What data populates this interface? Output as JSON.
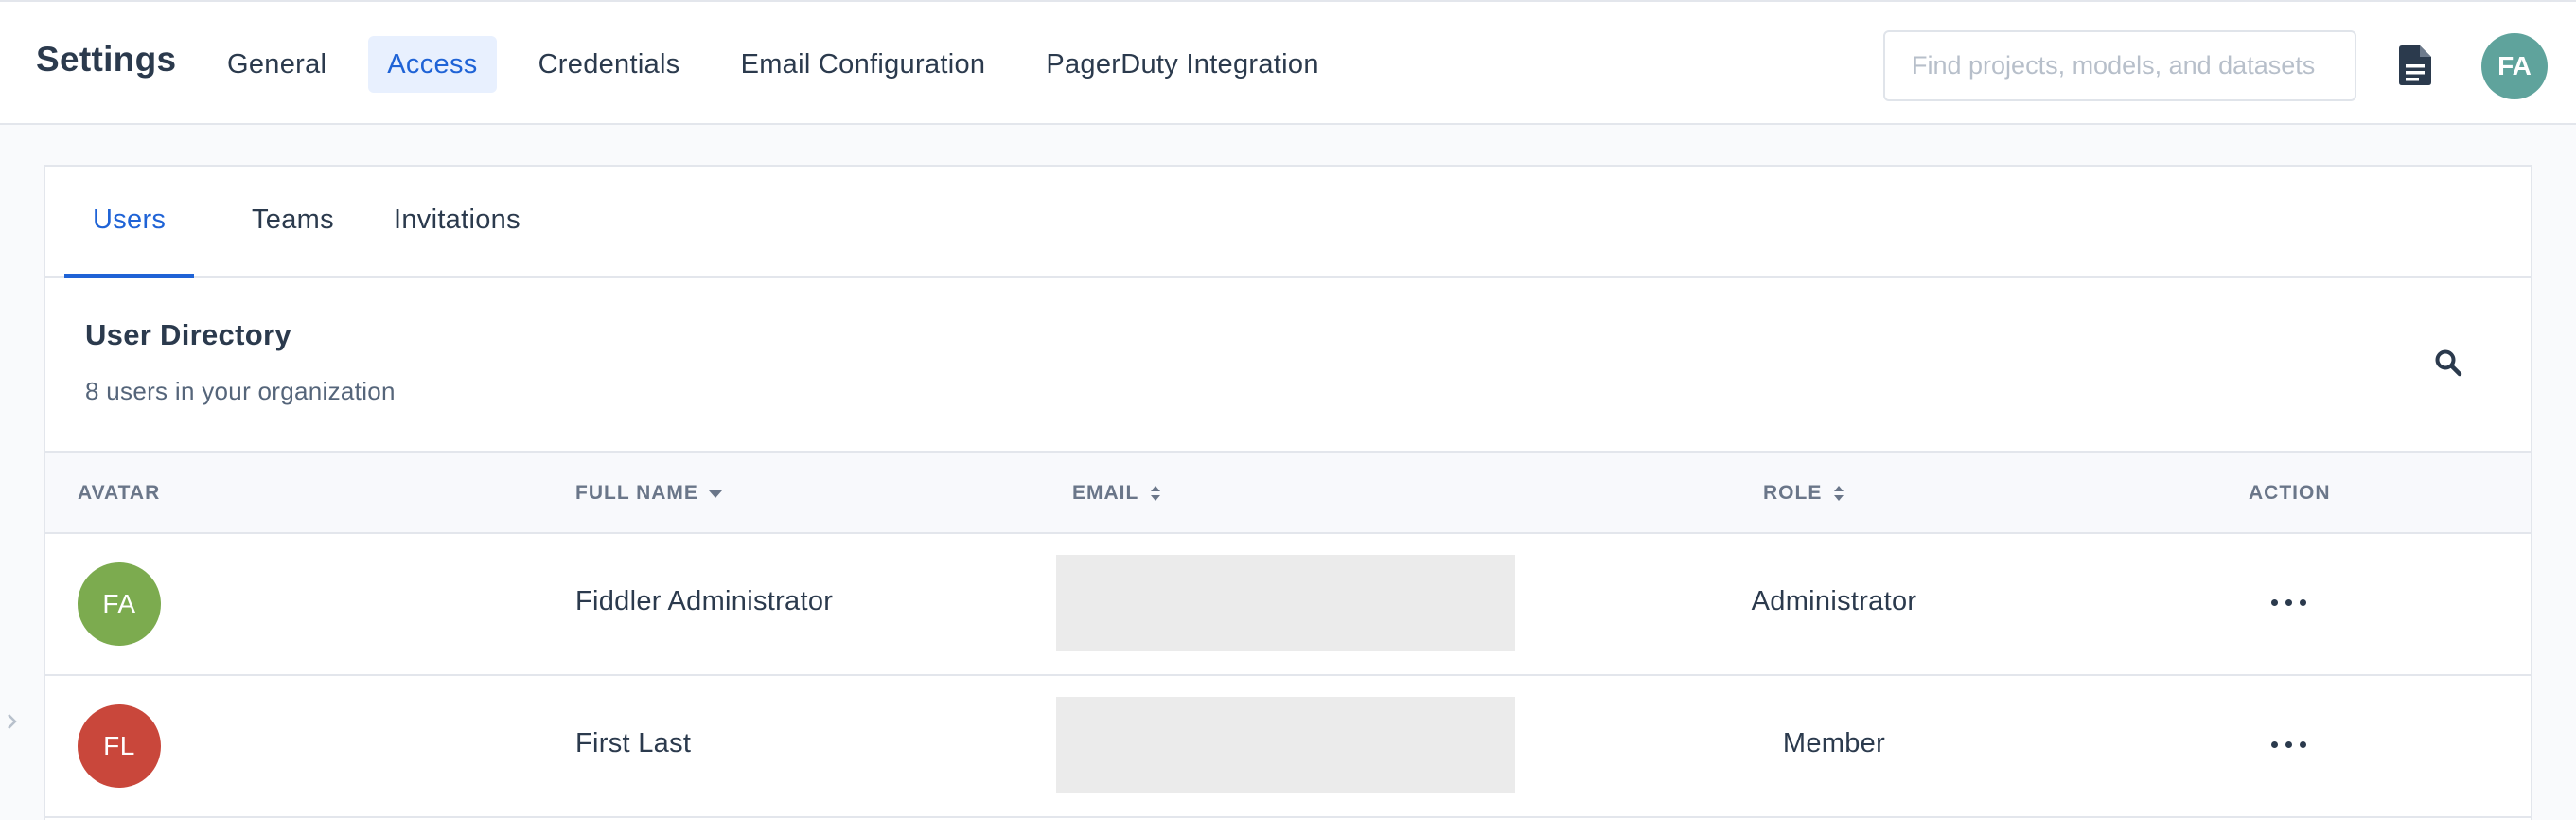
{
  "header": {
    "title": "Settings",
    "nav": [
      {
        "label": "General",
        "active": false
      },
      {
        "label": "Access",
        "active": true
      },
      {
        "label": "Credentials",
        "active": false
      },
      {
        "label": "Email Configuration",
        "active": false
      },
      {
        "label": "PagerDuty Integration",
        "active": false
      }
    ],
    "search": {
      "placeholder": "Find projects, models, and datasets",
      "value": ""
    },
    "docs_icon": "document-icon",
    "user_avatar": {
      "initials": "FA",
      "color": "#5fa39c"
    }
  },
  "tabs": [
    {
      "label": "Users",
      "active": true
    },
    {
      "label": "Teams",
      "active": false
    },
    {
      "label": "Invitations",
      "active": false
    }
  ],
  "directory": {
    "title": "User Directory",
    "subtitle": "8 users in your organization",
    "search_icon": "search-icon"
  },
  "table": {
    "columns": [
      "AVATAR",
      "FULL NAME",
      "EMAIL",
      "ROLE",
      "ACTION"
    ],
    "sort": {
      "column": "FULL NAME",
      "direction": "desc"
    },
    "rows": [
      {
        "initials": "FA",
        "avatar_color": "#7cab4f",
        "full_name": "Fiddler Administrator",
        "email": "",
        "role": "Administrator",
        "action_icon": "more-horizontal-icon"
      },
      {
        "initials": "FL",
        "avatar_color": "#c9473b",
        "full_name": "First Last",
        "email": "",
        "role": "Member",
        "action_icon": "more-horizontal-icon"
      }
    ]
  },
  "colors": {
    "accent": "#1f63d6",
    "active_nav_bg": "#e8f0fe",
    "text": "#2b3a4d",
    "redacted": "#ebebeb"
  }
}
